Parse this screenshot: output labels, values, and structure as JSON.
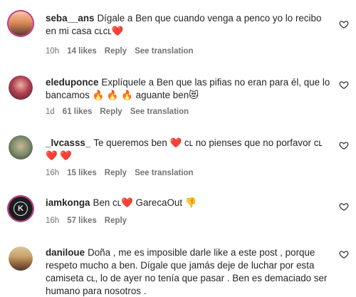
{
  "comments": [
    {
      "username": "seba__ans",
      "text": "Dígale a Ben que cuando venga a penco yo lo recibo en mi casa ᴄʟᴄʟ❤️",
      "time": "10h",
      "likes": "14 likes",
      "reply": "Reply",
      "translate": "See translation"
    },
    {
      "username": "eleduponce",
      "text": "Explíquele a Ben que las pifias no eran para él, que lo bancamos 🔥 🔥 🔥 aguante ben😻",
      "time": "1d",
      "likes": "61 likes",
      "reply": "Reply",
      "translate": "See translation"
    },
    {
      "username": "_lvcasss_",
      "text": "Te queremos ben ❤️ ᴄʟ no pienses que no porfavor ᴄʟ ❤️ ❤️",
      "time": "16h",
      "likes": "15 likes",
      "reply": "Reply",
      "translate": "See translation"
    },
    {
      "username": "iamkonga",
      "text": "Ben ᴄʟ❤️  GarecaOut 👎",
      "time": "16h",
      "likes": "57 likes",
      "reply": "Reply"
    },
    {
      "username": "daniloue",
      "text": "Doña , me es imposible darle like a este post , porque respeto mucho a ben. Dígale que jamás deje de luchar por esta camiseta ᴄʟ, lo de ayer no tenía que pasar . Ben es demaciado ser humano para nosotros ."
    }
  ],
  "icons": {
    "like": "heart-outline-icon",
    "avatar_konga": "k-logo-icon"
  },
  "colors": {
    "text": "#262626",
    "meta": "#737373",
    "story_ring": "#c13584"
  }
}
